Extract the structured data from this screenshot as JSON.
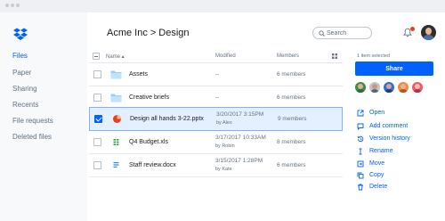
{
  "sidebar": {
    "items": [
      {
        "label": "Files"
      },
      {
        "label": "Paper"
      },
      {
        "label": "Sharing"
      },
      {
        "label": "Recents"
      },
      {
        "label": "File requests"
      },
      {
        "label": "Deleted files"
      }
    ]
  },
  "header": {
    "breadcrumb_root": "Acme Inc",
    "breadcrumb_sep": ">",
    "breadcrumb_current": "Design",
    "search_placeholder": "Search"
  },
  "table": {
    "columns": {
      "name": "Name ▴",
      "modified": "Modified",
      "members": "Members"
    },
    "rows": [
      {
        "name": "Assets",
        "modified": "--",
        "by": "",
        "members": "6 members",
        "icon": "folder-icon",
        "selected": false
      },
      {
        "name": "Creative briefs",
        "modified": "--",
        "by": "",
        "members": "6 members",
        "icon": "folder-icon",
        "selected": false
      },
      {
        "name": "Design all hands 3-22.pptx",
        "modified": "3/20/2017 3:15PM",
        "by": "by Alex",
        "members": "9 members",
        "icon": "pptx-icon",
        "selected": true
      },
      {
        "name": "Q4 Budget.xls",
        "modified": "3/17/2017 10:33AM",
        "by": "by Robin",
        "members": "8 members",
        "icon": "spreadsheet-icon",
        "selected": false
      },
      {
        "name": "Staff review.docx",
        "modified": "3/15/2017 1:28PM",
        "by": "by Kate",
        "members": "6 members",
        "icon": "document-icon",
        "selected": false
      }
    ]
  },
  "panel": {
    "selection_text": "1 item selected",
    "share_label": "Share",
    "actions": [
      {
        "label": "Open",
        "icon": "open-external-icon"
      },
      {
        "label": "Add comment",
        "icon": "comment-icon"
      },
      {
        "label": "Version history",
        "icon": "history-icon"
      },
      {
        "label": "Rename",
        "icon": "rename-icon"
      },
      {
        "label": "Move",
        "icon": "move-icon"
      },
      {
        "label": "Copy",
        "icon": "copy-icon"
      },
      {
        "label": "Delete",
        "icon": "trash-icon"
      }
    ]
  },
  "colors": {
    "accent": "#0061fe",
    "selected_row_bg": "#e4efff",
    "sidebar_bg": "#f7f9fa",
    "folder": "#92ceff",
    "notification": "#e3421b",
    "pptx": "#e3421b",
    "spreadsheet": "#2ca24f",
    "document": "#2f8de4"
  }
}
